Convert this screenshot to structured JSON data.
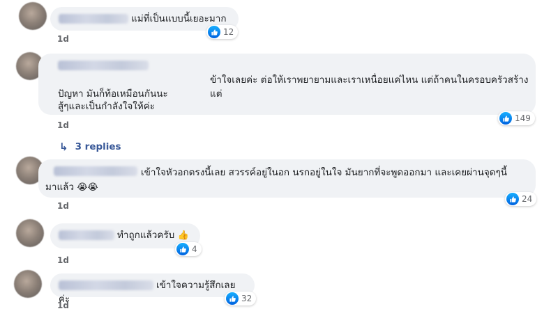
{
  "comments": [
    {
      "text": "แม่ที่เป็นแบบนี้เยอะมาก",
      "time": "1d",
      "likes": "12"
    },
    {
      "text": "ข้าใจเลยค่ะ ต่อให้เราพยายามและเราเหนื่อยแค่ไหน แต่ถ้าคนในครอบครัวสร้างแต่",
      "line2": "ปัญหา มันก็ท้อเหมือนกันนะ",
      "line3": "สู้ๆและเป็นกำลังใจให้ค่ะ",
      "time": "1d",
      "likes": "149"
    },
    {
      "text": "เข้าใจหัวอกตรงนี้เลย สวรรค์อยู่ในอก นรกอยู่ในใจ มันยากที่จะพูดออกมา และเคยผ่านจุดๆนี้",
      "line2": "มาแล้ว",
      "emoji": "😭😭",
      "time": "1d",
      "likes": "24"
    },
    {
      "text": "ทำถูกแล้วครับ",
      "emoji": "👍",
      "time": "1d",
      "likes": "4"
    },
    {
      "text": "เข้าใจความรู้สึกเลยค่ะ",
      "time": "1d",
      "likes": "32"
    }
  ],
  "replies_label": "3 replies",
  "colors": {
    "bubble": "#f0f2f5",
    "link": "#385898",
    "meta": "#65676b",
    "like_blue": "#1877f2"
  }
}
